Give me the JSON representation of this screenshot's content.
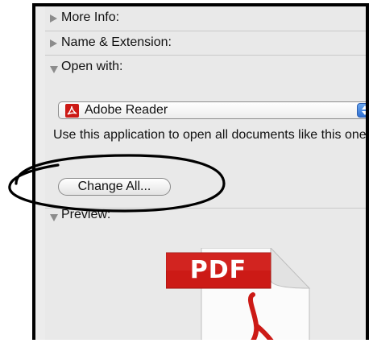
{
  "sections": {
    "more_info": "More Info:",
    "name_extension": "Name & Extension:",
    "open_with": "Open with:",
    "preview": "Preview:"
  },
  "open_with": {
    "selected_app": "Adobe Reader",
    "app_icon": "adobe-reader-icon",
    "description": "Use this application to open all documents like this one.",
    "change_all_label": "Change All..."
  },
  "preview": {
    "badge_text": "PDF",
    "icon": "pdf-document-icon"
  },
  "colors": {
    "panel_bg": "#e9e9e9",
    "pdf_red": "#cc1a16",
    "stepper_blue": "#3b7ddc",
    "annotation": "#000000"
  }
}
